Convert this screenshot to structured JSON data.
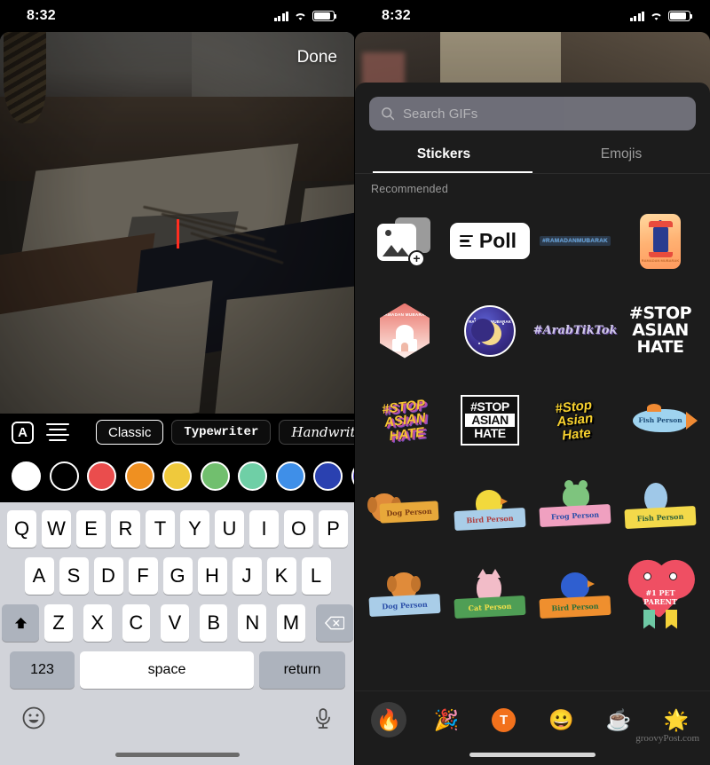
{
  "status_bar": {
    "time": "8:32",
    "icons": [
      "cellular-signal",
      "wifi",
      "battery"
    ]
  },
  "left_panel": {
    "name": "photo-text-editor",
    "done_label": "Done",
    "text_tools": {
      "style_icon": "A",
      "alignment_icon": "text-align-icon",
      "fonts": [
        {
          "label": "Classic",
          "selected": true
        },
        {
          "label": "Typewriter",
          "selected": false
        },
        {
          "label": "Handwriting",
          "selected": false
        }
      ],
      "colors": [
        "#ffffff",
        "#000000",
        "#ea4d4d",
        "#ef9021",
        "#efc93c",
        "#71bf6e",
        "#6fcfa6",
        "#3f8fe8",
        "#2a41b0",
        "#5a46d6"
      ]
    },
    "keyboard": {
      "row1": [
        "Q",
        "W",
        "E",
        "R",
        "T",
        "Y",
        "U",
        "I",
        "O",
        "P"
      ],
      "row2": [
        "A",
        "S",
        "D",
        "F",
        "G",
        "H",
        "J",
        "K",
        "L"
      ],
      "row3": [
        "Z",
        "X",
        "C",
        "V",
        "B",
        "N",
        "M"
      ],
      "shift_icon": "shift-arrow-icon",
      "backspace_icon": "backspace-icon",
      "numbers_label": "123",
      "space_label": "space",
      "return_label": "return",
      "emoji_icon": "emoji-face-icon",
      "mic_icon": "microphone-icon"
    }
  },
  "right_panel": {
    "name": "sticker-picker",
    "search": {
      "placeholder": "Search GIFs",
      "icon": "search-icon"
    },
    "tabs": [
      {
        "label": "Stickers",
        "active": true
      },
      {
        "label": "Emojis",
        "active": false
      }
    ],
    "section_title": "Recommended",
    "stickers": [
      [
        {
          "name": "add-photo-sticker",
          "kind": "photo-add",
          "text": ""
        },
        {
          "name": "poll-sticker",
          "kind": "poll",
          "text": "Poll"
        },
        {
          "name": "ramadan-mubarak-text-sticker",
          "kind": "bluetext",
          "text": "#RAMADANMUBARAK"
        },
        {
          "name": "lantern-sticker",
          "kind": "lantern",
          "text": "RAMADAN MUBARAK"
        }
      ],
      [
        {
          "name": "ramadan-mosque-hex-sticker",
          "kind": "hex",
          "text": "RAMADAN MUBARAK"
        },
        {
          "name": "ramadan-moon-sticker",
          "kind": "moon",
          "text": "RAMADAN MUBARAK"
        },
        {
          "name": "arab-tiktok-sticker",
          "kind": "arabtt",
          "text": "#ArabTikTok"
        },
        {
          "name": "stop-asian-hate-white-sticker",
          "kind": "stop-white",
          "text": "#STOP ASIAN HATE"
        }
      ],
      [
        {
          "name": "stop-asian-hate-yellow-sticker",
          "kind": "stop-yellow",
          "text": "#STOP ASIAN HATE"
        },
        {
          "name": "stop-asian-hate-box-sticker",
          "kind": "stop-box",
          "text": "#STOP ASIAN HATE"
        },
        {
          "name": "stop-asian-hate-script-sticker",
          "kind": "stop-script",
          "text": "#Stop Asian Hate"
        },
        {
          "name": "fish-person-blue-sticker",
          "kind": "fishblue",
          "text": "Fish Person"
        }
      ],
      [
        {
          "name": "dog-person-sticker",
          "kind": "animal-dog-flat",
          "text": "Dog Person"
        },
        {
          "name": "bird-person-yellow-sticker",
          "kind": "animal-bird-yellow",
          "text": "Bird Person"
        },
        {
          "name": "frog-person-sticker",
          "kind": "animal-frog",
          "text": "Frog Person"
        },
        {
          "name": "fish-person-banner-sticker",
          "kind": "animal-fish",
          "text": "Fish Person"
        }
      ],
      [
        {
          "name": "dog-person-banner-sticker",
          "kind": "animal-dog",
          "text": "Dog Person"
        },
        {
          "name": "cat-person-sticker",
          "kind": "animal-cat",
          "text": "Cat Person"
        },
        {
          "name": "bird-person-blue-sticker",
          "kind": "animal-bluebird",
          "text": "Bird Person"
        },
        {
          "name": "pet-parent-sticker",
          "kind": "heart",
          "text": "#1 PET PARENT"
        }
      ]
    ],
    "categories": [
      {
        "name": "trending-category",
        "icon": "🔥",
        "selected": true
      },
      {
        "name": "celebration-category",
        "icon": "🎉",
        "selected": false
      },
      {
        "name": "text-category",
        "icon": "T",
        "selected": false
      },
      {
        "name": "smileys-category",
        "icon": "😀",
        "selected": false
      },
      {
        "name": "food-drink-category",
        "icon": "☕",
        "selected": false
      },
      {
        "name": "weather-category",
        "icon": "🌟",
        "selected": false
      }
    ],
    "watermark": "groovyPost.com"
  }
}
